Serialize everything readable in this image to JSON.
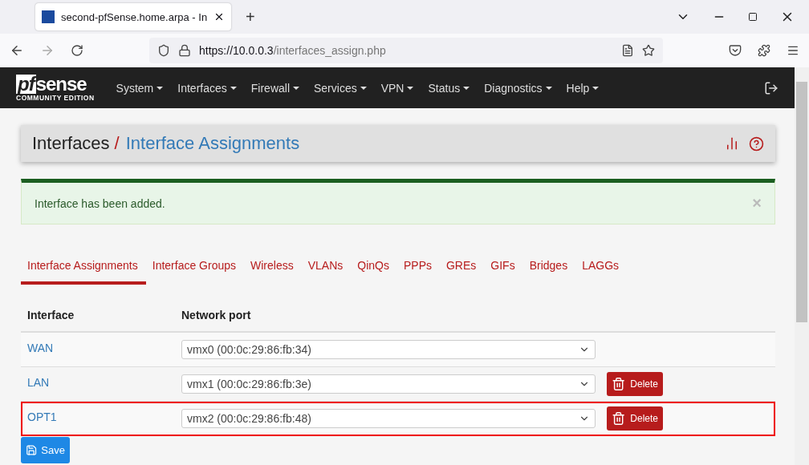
{
  "browser": {
    "tab_title": "second-pfSense.home.arpa - In",
    "new_tab": "+",
    "url_host": "https://10.0.0.3",
    "url_path": "/interfaces_assign.php"
  },
  "brand": {
    "logo_pf": "pf",
    "logo_sense": "sense",
    "edition": "COMMUNITY EDITION"
  },
  "nav": [
    "System",
    "Interfaces",
    "Firewall",
    "Services",
    "VPN",
    "Status",
    "Diagnostics",
    "Help"
  ],
  "breadcrumb": {
    "parent": "Interfaces",
    "separator": "/",
    "current": "Interface Assignments"
  },
  "alert": {
    "message": "Interface has been added.",
    "close": "×"
  },
  "tabs": [
    {
      "label": "Interface Assignments",
      "selected": true
    },
    {
      "label": "Interface Groups",
      "selected": false
    },
    {
      "label": "Wireless",
      "selected": false
    },
    {
      "label": "VLANs",
      "selected": false
    },
    {
      "label": "QinQs",
      "selected": false
    },
    {
      "label": "PPPs",
      "selected": false
    },
    {
      "label": "GREs",
      "selected": false
    },
    {
      "label": "GIFs",
      "selected": false
    },
    {
      "label": "Bridges",
      "selected": false
    },
    {
      "label": "LAGGs",
      "selected": false
    }
  ],
  "table": {
    "columns": [
      "Interface",
      "Network port"
    ],
    "rows": [
      {
        "interface": "WAN",
        "port": "vmx0 (00:0c:29:86:fb:34)",
        "delete": null,
        "highlighted": false
      },
      {
        "interface": "LAN",
        "port": "vmx1 (00:0c:29:86:fb:3e)",
        "delete": "Delete",
        "highlighted": false
      },
      {
        "interface": "OPT1",
        "port": "vmx2 (00:0c:29:86:fb:48)",
        "delete": "Delete",
        "highlighted": true
      }
    ]
  },
  "save_button": "Save"
}
